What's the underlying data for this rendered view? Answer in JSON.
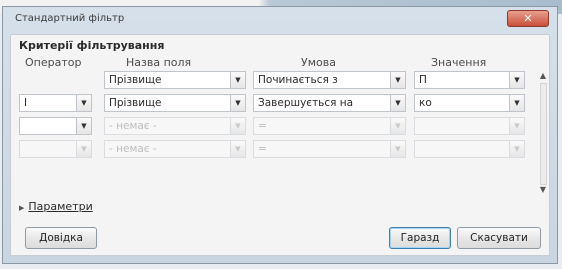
{
  "window": {
    "title": "Стандартний фільтр",
    "close_glyph": "✕"
  },
  "section_title": "Критерії фільтрування",
  "columns": {
    "operator": "Оператор",
    "field": "Назва поля",
    "condition": "Умова",
    "value": "Значення"
  },
  "rows": [
    {
      "operator": "",
      "field": "Прізвище",
      "condition": "Починається з",
      "value": "П",
      "disabled": false
    },
    {
      "operator": "І",
      "field": "Прізвище",
      "condition": "Завершується на",
      "value": "ко",
      "disabled": false
    },
    {
      "operator": "",
      "field": "- немає -",
      "condition": "=",
      "value": "",
      "disabled": true
    },
    {
      "operator": "",
      "field": "- немає -",
      "condition": "=",
      "value": "",
      "disabled": true
    }
  ],
  "options_label": "Параметри",
  "buttons": {
    "help": "Довідка",
    "ok": "Гаразд",
    "cancel": "Скасувати"
  },
  "icons": {
    "dropdown": "dropdown-arrow-icon",
    "expand": "expand-triangle-icon",
    "close": "close-icon"
  }
}
